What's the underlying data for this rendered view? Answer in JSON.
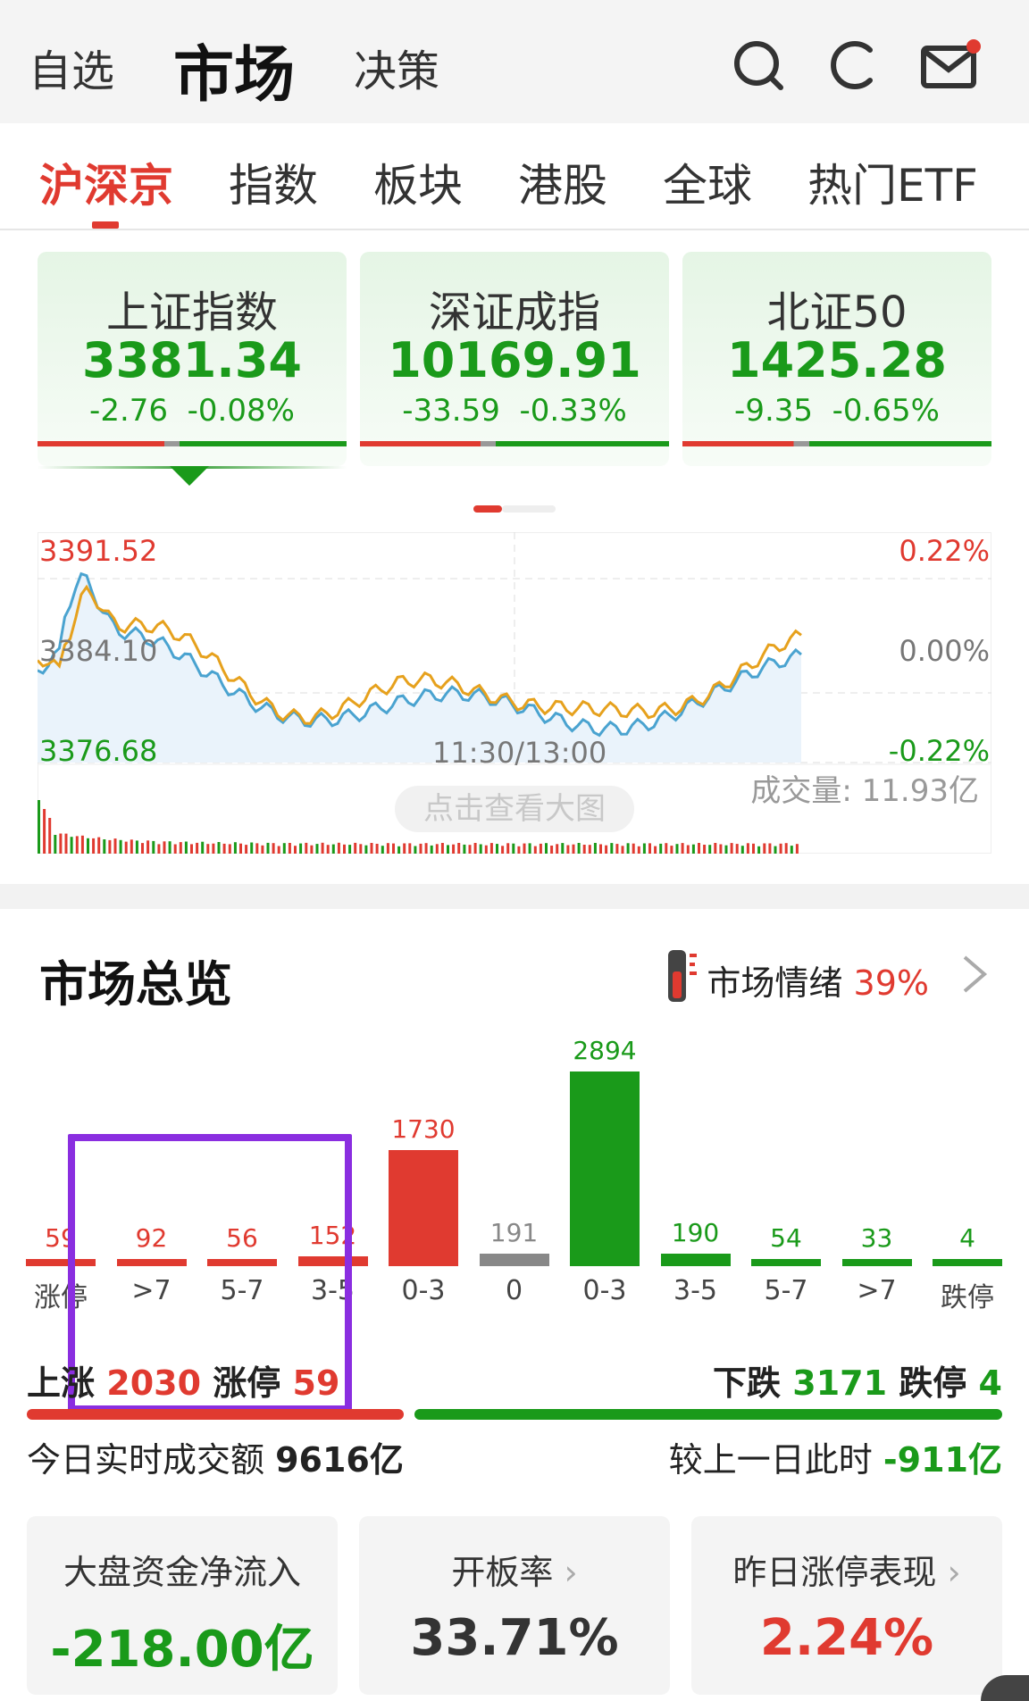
{
  "header": {
    "tabs": [
      "自选",
      "市场",
      "决策"
    ],
    "active_tab": "市场"
  },
  "subtabs": [
    "沪深京",
    "指数",
    "板块",
    "港股",
    "全球",
    "热门ETF"
  ],
  "indices": [
    {
      "name": "上证指数",
      "value": "3381.34",
      "change": "-2.76",
      "pct": "-0.08%",
      "up_ratio": 0.41
    },
    {
      "name": "深证成指",
      "value": "10169.91",
      "change": "-33.59",
      "pct": "-0.33%",
      "up_ratio": 0.39
    },
    {
      "name": "北证50",
      "value": "1425.28",
      "change": "-9.35",
      "pct": "-0.65%",
      "up_ratio": 0.36
    }
  ],
  "chart": {
    "high": "3391.52",
    "mid": "3384.10",
    "low": "3376.68",
    "pct_high": "0.22%",
    "pct_mid": "0.00%",
    "pct_low": "-0.22%",
    "time_label": "11:30/13:00",
    "volume": "成交量: 11.93亿",
    "bigview": "点击查看大图",
    "colors": {
      "white_line": "#e6a11d",
      "yellow_line": "#4aa3d0",
      "fill": "#e9f3fb"
    }
  },
  "overview": {
    "title": "市场总览",
    "mood_label": "市场情绪",
    "mood_value": "39%",
    "distribution": [
      {
        "count": "59",
        "label": "涨停",
        "value": 59,
        "color": "#e03a30"
      },
      {
        "count": "92",
        "label": ">7",
        "value": 92,
        "color": "#e03a30"
      },
      {
        "count": "56",
        "label": "5-7",
        "value": 56,
        "color": "#e03a30"
      },
      {
        "count": "152",
        "label": "3-5",
        "value": 152,
        "color": "#e03a30"
      },
      {
        "count": "1730",
        "label": "0-3",
        "value": 1730,
        "color": "#e03a30"
      },
      {
        "count": "191",
        "label": "0",
        "value": 191,
        "color": "#888888"
      },
      {
        "count": "2894",
        "label": "0-3",
        "value": 2894,
        "color": "#1a9a1a"
      },
      {
        "count": "190",
        "label": "3-5",
        "value": 190,
        "color": "#1a9a1a"
      },
      {
        "count": "54",
        "label": "5-7",
        "value": 54,
        "color": "#1a9a1a"
      },
      {
        "count": "33",
        "label": ">7",
        "value": 33,
        "color": "#1a9a1a"
      },
      {
        "count": "4",
        "label": "跌停",
        "value": 4,
        "color": "#1a9a1a"
      }
    ],
    "up_label": "上涨",
    "up_value": "2030",
    "limit_up_label": "涨停",
    "limit_up_value": "59",
    "down_label": "下跌",
    "down_value": "3171",
    "limit_down_label": "跌停",
    "limit_down_value": "4",
    "turnover_label": "今日实时成交额",
    "turnover_value": "9616亿",
    "compare_label": "较上一日此时",
    "compare_value": "-911亿"
  },
  "cards": [
    {
      "label": "大盘资金净流入",
      "value": "-218.00亿",
      "color": "#1a9a1a"
    },
    {
      "label": "开板率",
      "value": "33.71%",
      "color": "#333333"
    },
    {
      "label": "昨日涨停表现",
      "value": "2.24%",
      "color": "#e03a30"
    }
  ]
}
